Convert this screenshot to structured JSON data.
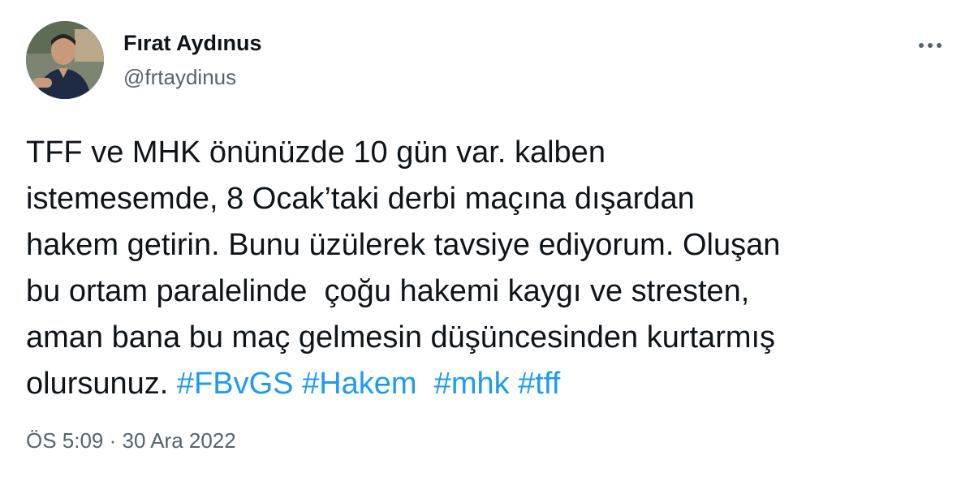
{
  "author": {
    "name": "Fırat Aydınus",
    "handle": "@frtaydinus"
  },
  "menu": {
    "icon": "more-horizontal-icon"
  },
  "tweet": {
    "lines": [
      "TFF ve MHK önünüzde 10 gün var. kalben",
      "istemesemde, 8 Ocak’taki derbi maçına dışardan",
      "hakem getirin. Bunu üzülerek tavsiye ediyorum. Oluşan",
      "bu ortam paralelinde  çoğu hakemi kaygı ve stresten,",
      "aman bana bu maç gelmesin düşüncesinden kurtarmış",
      "olursunuz. "
    ],
    "hashtags": [
      "#FBvGS",
      "#Hakem",
      "#mhk",
      "#tff"
    ]
  },
  "timestamp": "ÖS 5:09 · 30 Ara 2022",
  "colors": {
    "text": "#0f1419",
    "secondary": "#536471",
    "link": "#1d9bf0"
  }
}
